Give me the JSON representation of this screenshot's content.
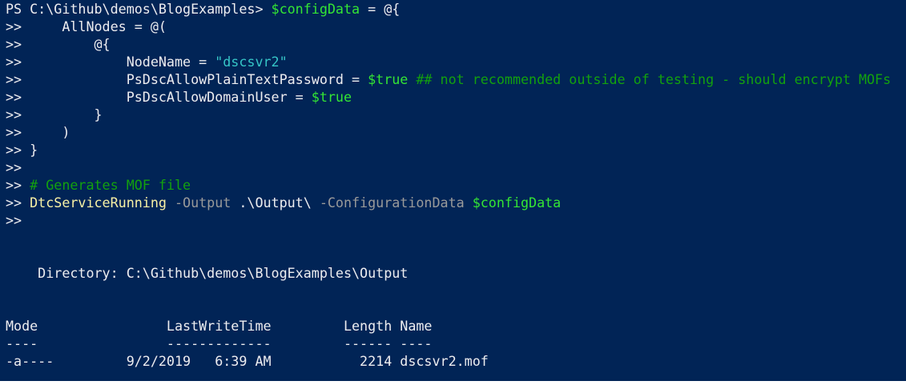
{
  "window": {
    "type": "PowerShell console",
    "background": "#012456"
  },
  "colors": {
    "default": "#eeedf0",
    "variable": "#34e534",
    "string": "#36c5c7",
    "comment": "#13a10e",
    "command": "#f9f1a5",
    "parameter": "#9a9a9a"
  },
  "lines": [
    [
      {
        "t": "PS C:\\Github\\demos\\BlogExamples> ",
        "k": "default"
      },
      {
        "t": "$configData",
        "k": "variable"
      },
      {
        "t": " = @{",
        "k": "default"
      }
    ],
    [
      {
        "t": ">>     AllNodes = @(",
        "k": "default"
      }
    ],
    [
      {
        "t": ">>         @{",
        "k": "default"
      }
    ],
    [
      {
        "t": ">>             NodeName = ",
        "k": "default"
      },
      {
        "t": "\"dscsvr2\"",
        "k": "string"
      }
    ],
    [
      {
        "t": ">>             PsDscAllowPlainTextPassword = ",
        "k": "default"
      },
      {
        "t": "$true",
        "k": "variable"
      },
      {
        "t": " ## not recommended outside of testing - should encrypt MOFs",
        "k": "comment"
      }
    ],
    [
      {
        "t": ">>             PsDscAllowDomainUser = ",
        "k": "default"
      },
      {
        "t": "$true",
        "k": "variable"
      }
    ],
    [
      {
        "t": ">>         }",
        "k": "default"
      }
    ],
    [
      {
        "t": ">>     )",
        "k": "default"
      }
    ],
    [
      {
        "t": ">> }",
        "k": "default"
      }
    ],
    [
      {
        "t": ">>",
        "k": "default"
      }
    ],
    [
      {
        "t": ">> ",
        "k": "default"
      },
      {
        "t": "# Generates MOF file",
        "k": "comment"
      }
    ],
    [
      {
        "t": ">> ",
        "k": "default"
      },
      {
        "t": "DtcServiceRunning",
        "k": "command"
      },
      {
        "t": " -Output",
        "k": "parameter"
      },
      {
        "t": " .\\Output\\",
        "k": "default"
      },
      {
        "t": " -ConfigurationData",
        "k": "parameter"
      },
      {
        "t": " ",
        "k": "default"
      },
      {
        "t": "$configData",
        "k": "variable"
      }
    ],
    [
      {
        "t": ">>",
        "k": "default"
      }
    ],
    [],
    [],
    [
      {
        "t": "    Directory: C:\\Github\\demos\\BlogExamples\\Output",
        "k": "default"
      }
    ],
    [],
    [],
    [
      {
        "t": "Mode                LastWriteTime         Length Name",
        "k": "default"
      }
    ],
    [
      {
        "t": "----                -------------         ------ ----",
        "k": "default"
      }
    ],
    [
      {
        "t": "-a----         9/2/2019   6:39 AM           2214 dscsvr2.mof",
        "k": "default"
      }
    ]
  ]
}
